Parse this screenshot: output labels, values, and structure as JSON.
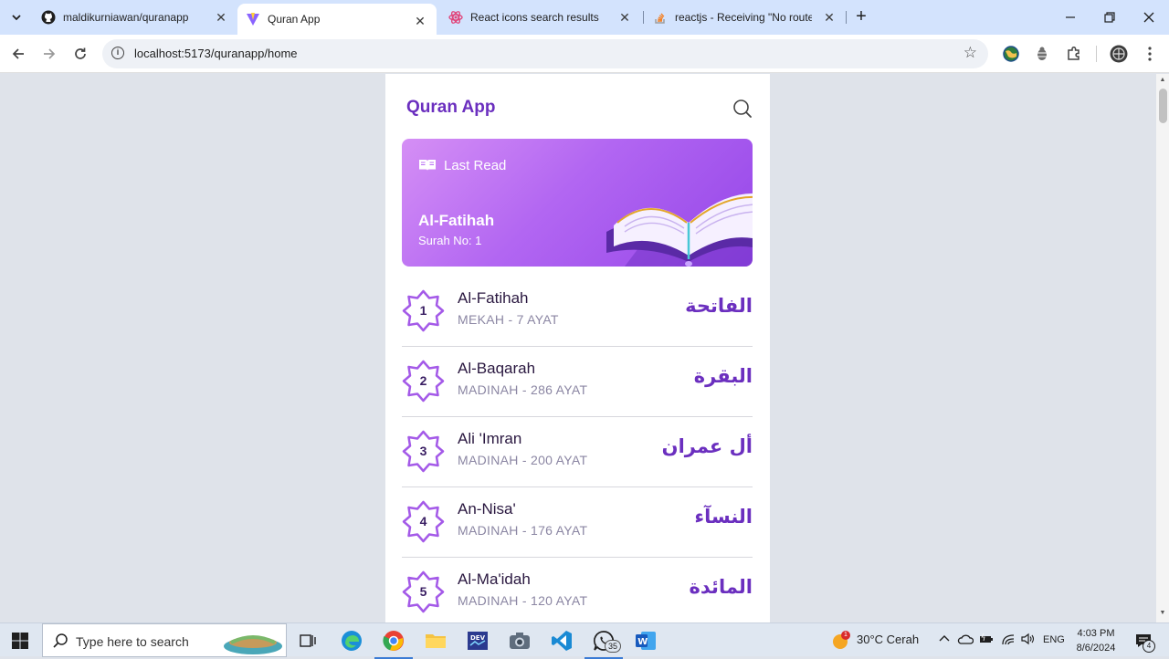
{
  "browser": {
    "tabs": [
      {
        "title": "maldikurniawan/quranapp",
        "icon": "github-icon",
        "active": false
      },
      {
        "title": "Quran App",
        "icon": "vite-icon",
        "active": true
      },
      {
        "title": "React icons search results",
        "icon": "react-icons-icon",
        "active": false
      },
      {
        "title": "reactjs - Receiving \"No routes m",
        "icon": "stackoverflow-icon",
        "active": false
      }
    ],
    "new_tab_label": "+",
    "url": "localhost:5173/quranapp/home"
  },
  "app": {
    "title": "Quran App",
    "last_read": {
      "label": "Last Read",
      "surah_name": "Al-Fatihah",
      "surah_no": "Surah No: 1"
    },
    "surahs": [
      {
        "number": "1",
        "name": "Al-Fatihah",
        "meta": "MEKAH - 7 AYAT",
        "arabic": "الفاتحة"
      },
      {
        "number": "2",
        "name": "Al-Baqarah",
        "meta": "MADINAH - 286 AYAT",
        "arabic": "البقرة"
      },
      {
        "number": "3",
        "name": "Ali 'Imran",
        "meta": "MADINAH - 200 AYAT",
        "arabic": "أل عمران"
      },
      {
        "number": "4",
        "name": "An-Nisa'",
        "meta": "MADINAH - 176 AYAT",
        "arabic": "النسآء"
      },
      {
        "number": "5",
        "name": "Al-Ma'idah",
        "meta": "MADINAH - 120 AYAT",
        "arabic": "المائدة"
      }
    ],
    "colors": {
      "primary": "#6b2fbf",
      "card_start": "#d58ff5",
      "card_end": "#9546e8"
    }
  },
  "taskbar": {
    "search_placeholder": "Type here to search",
    "whatsapp_badge": "35",
    "weather_badge": "1",
    "weather": "30°C  Cerah",
    "language": "ENG",
    "time": "4:03 PM",
    "date": "8/6/2024",
    "notification_count": "4"
  }
}
